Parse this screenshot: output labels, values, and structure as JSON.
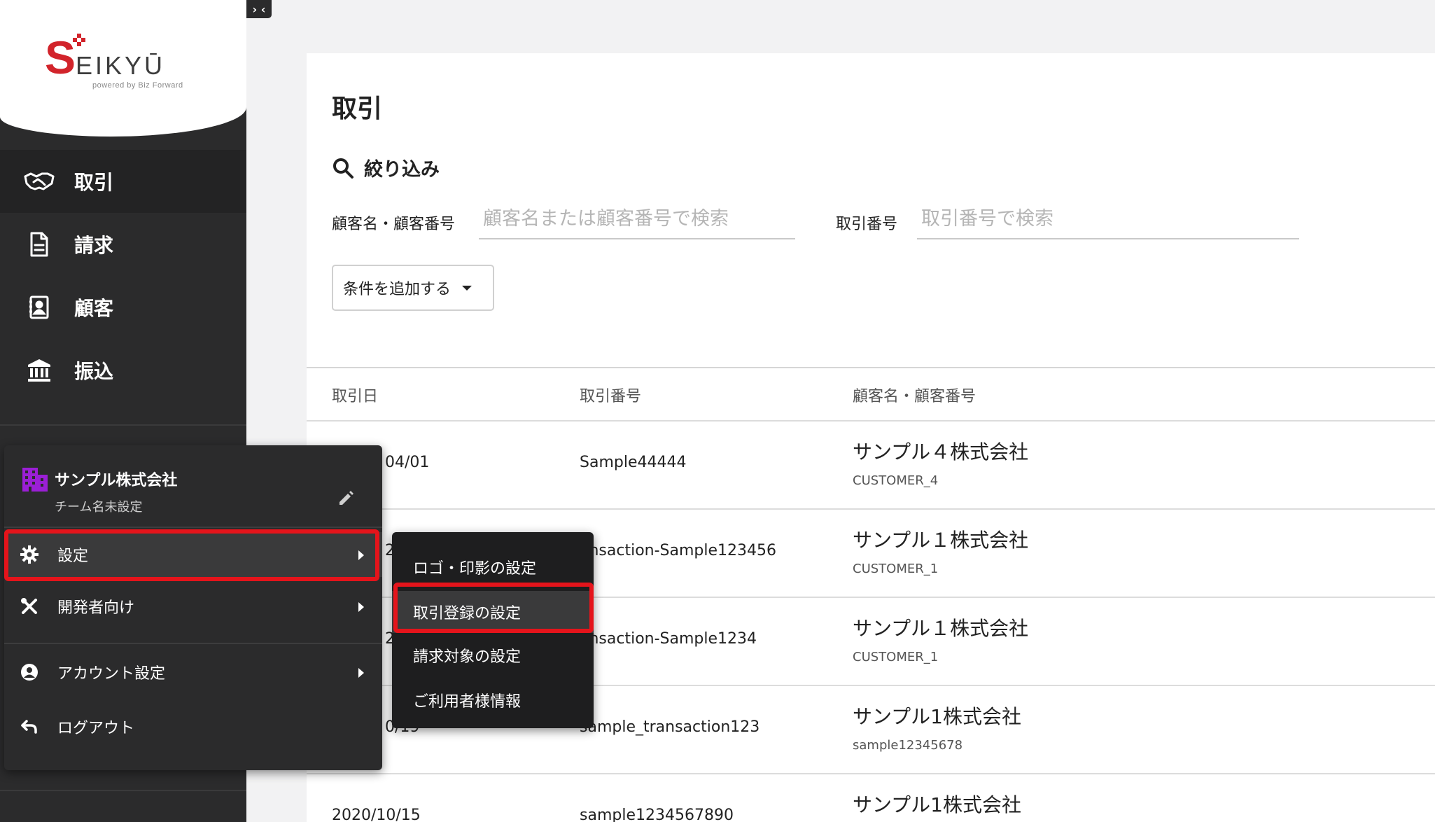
{
  "brand": {
    "logo_initial": "S",
    "logo_word": "EIKYŪ",
    "tagline": "powered by Biz Forward",
    "accent_color": "#d2242b"
  },
  "sidebar": {
    "toggle_icon": "collapse-icon",
    "toggle_glyph": "› ‹",
    "items": [
      {
        "label": "取引",
        "icon": "handshake-icon",
        "active": true
      },
      {
        "label": "請求",
        "icon": "document-icon",
        "active": false
      },
      {
        "label": "顧客",
        "icon": "contact-book-icon",
        "active": false
      },
      {
        "label": "振込",
        "icon": "bank-icon",
        "active": false
      }
    ]
  },
  "main": {
    "title": "取引",
    "filter": {
      "heading": "絞り込み",
      "customer_label": "顧客名・顧客番号",
      "customer_placeholder": "顧客名または顧客番号で検索",
      "txn_label": "取引番号",
      "txn_placeholder": "取引番号で検索",
      "add_condition_label": "条件を追加する"
    },
    "table": {
      "headers": [
        "取引日",
        "取引番号",
        "顧客名・顧客番号"
      ],
      "rows": [
        {
          "date": "04/01",
          "txn_no": "Sample44444",
          "customer": "サンプル４株式会社",
          "customer_no": "CUSTOMER_4"
        },
        {
          "date": "2",
          "txn_no": "ansaction-Sample123456",
          "customer": "サンプル１株式会社",
          "customer_no": "CUSTOMER_1"
        },
        {
          "date": "2",
          "txn_no": "ansaction-Sample1234",
          "customer": "サンプル１株式会社",
          "customer_no": "CUSTOMER_1"
        },
        {
          "date": "0/19",
          "txn_no": "sample_transaction123",
          "customer": "サンプル1株式会社",
          "customer_no": "sample12345678"
        },
        {
          "date": "2020/10/15",
          "txn_no": "sample1234567890",
          "customer": "サンプル1株式会社",
          "customer_no": ""
        }
      ]
    }
  },
  "account_menu": {
    "team_name": "サンプル株式会社",
    "team_subtitle": "チーム名未設定",
    "items": [
      {
        "label": "設定",
        "icon": "gear-icon",
        "has_submenu": true
      },
      {
        "label": "開発者向け",
        "icon": "tools-icon",
        "has_submenu": true
      },
      {
        "label": "アカウント設定",
        "icon": "account-circle-icon",
        "has_submenu": true
      },
      {
        "label": "ログアウト",
        "icon": "logout-icon",
        "has_submenu": false
      }
    ]
  },
  "settings_submenu": {
    "items": [
      {
        "label": "ロゴ・印影の設定"
      },
      {
        "label": "取引登録の設定"
      },
      {
        "label": "請求対象の設定"
      },
      {
        "label": "ご利用者様情報"
      }
    ]
  },
  "highlight_color": "#e5141b"
}
